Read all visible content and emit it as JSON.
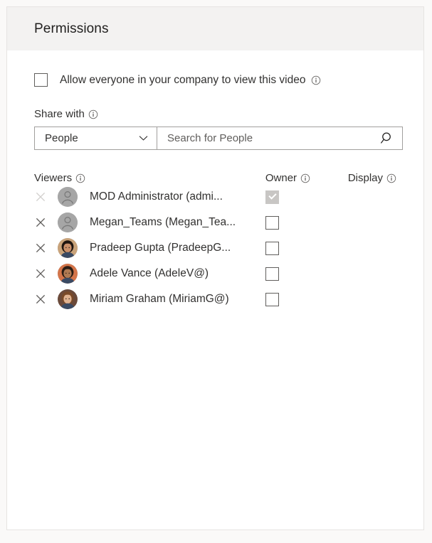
{
  "panel": {
    "title": "Permissions"
  },
  "allow_everyone": {
    "label": "Allow everyone in your company to view this video",
    "checked": false,
    "info_icon": "info-icon"
  },
  "share_with": {
    "label": "Share with",
    "info_icon": "info-icon",
    "type_value": "People",
    "type_options": [
      "People"
    ],
    "chevron_icon": "chevron-down-icon",
    "search_placeholder": "Search for People",
    "search_value": "",
    "search_icon": "search-icon"
  },
  "table": {
    "headers": {
      "viewers": "Viewers",
      "owner": "Owner",
      "display": "Display"
    },
    "rows": [
      {
        "name": "MOD Administrator (admi...",
        "avatar_type": "placeholder",
        "avatar_color": "#a6a6a6",
        "owner_checked": true,
        "owner_disabled": true,
        "remove_disabled": true,
        "remove_icon": "close-icon"
      },
      {
        "name": "Megan_Teams (Megan_Tea...",
        "avatar_type": "placeholder",
        "avatar_color": "#a6a6a6",
        "owner_checked": false,
        "owner_disabled": false,
        "remove_disabled": false,
        "remove_icon": "close-icon"
      },
      {
        "name": "Pradeep Gupta (PradeepG...",
        "avatar_type": "photo",
        "avatar_color": "#c9a37a",
        "owner_checked": false,
        "owner_disabled": false,
        "remove_disabled": false,
        "remove_icon": "close-icon"
      },
      {
        "name": "Adele Vance (AdeleV@)",
        "avatar_type": "photo",
        "avatar_color": "#d4754a",
        "owner_checked": false,
        "owner_disabled": false,
        "remove_disabled": false,
        "remove_icon": "close-icon"
      },
      {
        "name": "Miriam Graham (MiriamG@)",
        "avatar_type": "photo",
        "avatar_color": "#6b4a3a",
        "owner_checked": false,
        "owner_disabled": false,
        "remove_disabled": false,
        "remove_icon": "close-icon"
      }
    ]
  },
  "colors": {
    "header_bg": "#f3f2f1",
    "panel_border": "#e6e4e2",
    "text": "#323130",
    "control_border": "#a19f9d",
    "checkbox_border": "#605e5c",
    "checkbox_disabled_fill": "#c8c6c4"
  }
}
